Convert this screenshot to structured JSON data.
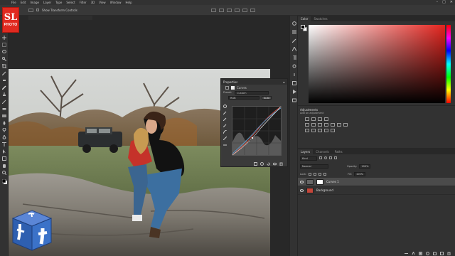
{
  "logo": {
    "line1": "SL",
    "line2": "PHOTO"
  },
  "menu": [
    "File",
    "Edit",
    "Image",
    "Layer",
    "Type",
    "Select",
    "Filter",
    "3D",
    "View",
    "Window",
    "Help"
  ],
  "window_controls": [
    "–",
    "□",
    "✕"
  ],
  "options_bar": {
    "show_transform_label": "Show Transform Controls"
  },
  "properties": {
    "title": "Properties",
    "adjustment": "Curves",
    "preset_label": "Preset:",
    "preset_value": "Custom",
    "channel_value": "RGB",
    "auto_label": "Auto"
  },
  "color_panel": {
    "tabs": [
      "Color",
      "Swatches"
    ],
    "accent": "#e3241e"
  },
  "adjustments": {
    "title": "Adjustments",
    "add_label": "Add an adjustment"
  },
  "layers": {
    "tabs": [
      "Layers",
      "Channels",
      "Paths"
    ],
    "kind_label": "Kind",
    "blend_mode": "Normal",
    "opacity_label": "Opacity:",
    "opacity_value": "100%",
    "lock_label": "Lock:",
    "fill_label": "Fill:",
    "fill_value": "100%",
    "items": [
      {
        "name": "Curves 1",
        "selected": true
      },
      {
        "name": "Background",
        "selected": false
      }
    ]
  },
  "colors": {
    "brand_red": "#e02a20",
    "facebook_blue": "#2e5fb0"
  }
}
